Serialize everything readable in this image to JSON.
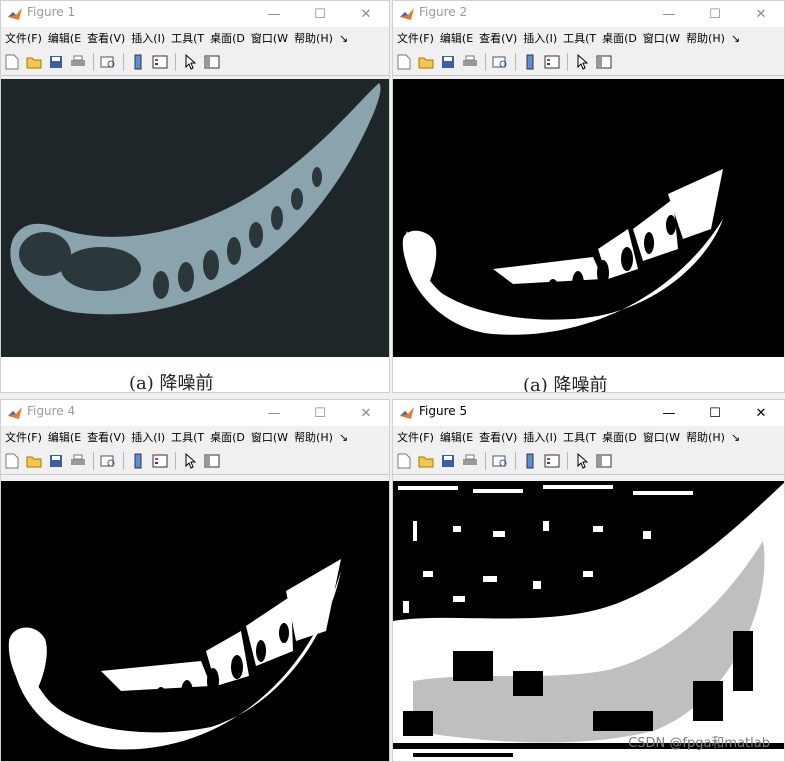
{
  "menu_labels": [
    "文件(F)",
    "编辑(E",
    "查看(V)",
    "插入(I)",
    "工具(T",
    "桌面(D",
    "窗口(W",
    "帮助(H)"
  ],
  "menu_more": "↘",
  "window_controls": {
    "minimize": "—",
    "maximize": "☐",
    "close": "✕"
  },
  "figures": [
    {
      "title": "Figure 1",
      "caption": "(a) 降噪前",
      "content": "grayscale blade image"
    },
    {
      "title": "Figure 2",
      "caption": "(a) 降噪前",
      "content": "binary blade image"
    },
    {
      "title": "Figure 4",
      "content": "binary blade image"
    },
    {
      "title": "Figure 5",
      "content": "binary noisy segmentation",
      "active": true
    }
  ],
  "watermark": "CSDN @fpga和matlab",
  "icons": [
    "new-file-icon",
    "open-folder-icon",
    "save-icon",
    "print-icon",
    "print-preview-icon",
    "colorbar-icon",
    "legend-icon",
    "pointer-icon",
    "property-editor-icon"
  ]
}
